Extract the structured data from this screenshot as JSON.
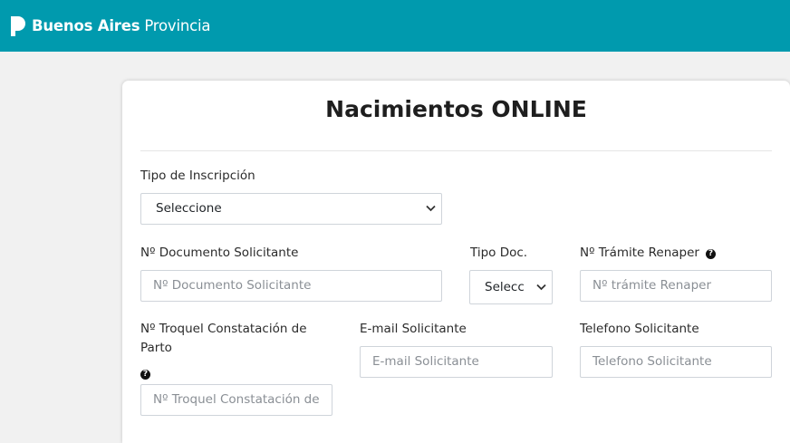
{
  "header": {
    "brand_bold": "Buenos Aires",
    "brand_light": "Provincia",
    "logo_icon": "province-logo-icon",
    "bg_color": "#009aae"
  },
  "form": {
    "title": "Nacimientos ONLINE",
    "tipo_inscripcion": {
      "label": "Tipo de Inscripción",
      "value": "Seleccione"
    },
    "doc_solicitante": {
      "label": "Nº Documento Solicitante",
      "placeholder": "Nº Documento Solicitante"
    },
    "tipo_doc": {
      "label": "Tipo Doc.",
      "value": "Selecc"
    },
    "tramite_renaper": {
      "label": "Nº Trámite Renaper",
      "placeholder": "Nº trámite Renaper"
    },
    "troquel": {
      "label_line1": "Nº Troquel Constatación de",
      "label_line2": "Parto",
      "placeholder": "Nº Troquel Constatación de"
    },
    "email": {
      "label": "E-mail Solicitante",
      "placeholder": "E-mail Solicitante"
    },
    "telefono": {
      "label": "Telefono Solicitante",
      "placeholder": "Telefono Solicitante"
    },
    "help_glyph": "?"
  }
}
